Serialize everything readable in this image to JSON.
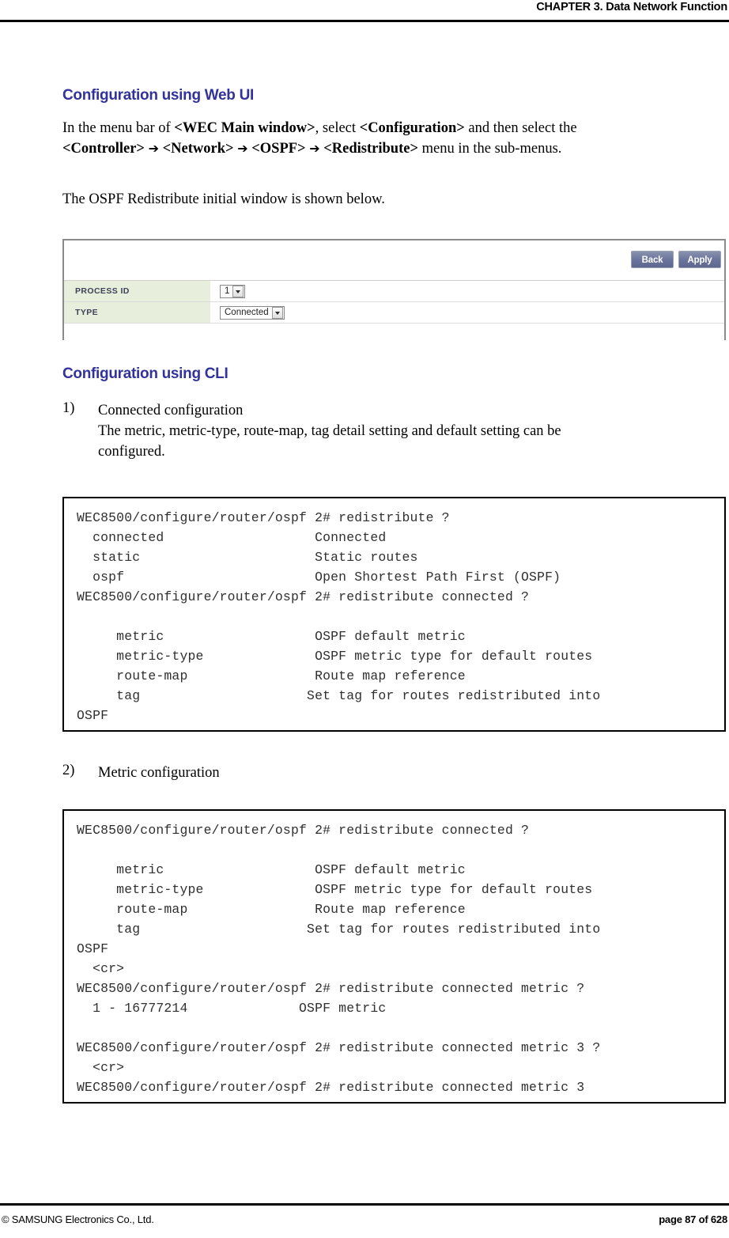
{
  "header": {
    "chapter_title": "CHAPTER 3. Data Network Function"
  },
  "sections": {
    "webui_heading": "Configuration using Web UI",
    "webui_para_line1_a": "In the menu bar of ",
    "webui_para_line1_b": "<WEC Main window>",
    "webui_para_line1_c": ", select ",
    "webui_para_line1_d": "<Configuration>",
    "webui_para_line1_e": " and then select the",
    "webui_para_line2_a": "<Controller>",
    "webui_para_line2_arrow1": "➔",
    "webui_para_line2_b": "<Network>",
    "webui_para_line2_arrow2": "➔",
    "webui_para_line2_c": "<OSPF>",
    "webui_para_line2_arrow3": "➔",
    "webui_para_line2_d": "<Redistribute>",
    "webui_para_line2_e": " menu in the sub-menus.",
    "webui_para2": "The OSPF Redistribute initial window is shown below.",
    "cli_heading": "Configuration using CLI"
  },
  "webui_panel": {
    "back_label": "Back",
    "apply_label": "Apply",
    "rows": [
      {
        "label": "PROCESS ID",
        "value": "1"
      },
      {
        "label": "TYPE",
        "value": "Connected"
      }
    ]
  },
  "cli_items": [
    {
      "number": "1)",
      "title": "Connected configuration",
      "desc_line1": "The metric, metric-type, route-map, tag detail setting and default setting can be",
      "desc_line2": "configured."
    },
    {
      "number": "2)",
      "title": "Metric configuration"
    }
  ],
  "cli_blocks": [
    {
      "id": "connected-configuration-output",
      "text": "WEC8500/configure/router/ospf 2# redistribute ?\n  connected                   Connected\n  static                      Static routes\n  ospf                        Open Shortest Path First (OSPF)\nWEC8500/configure/router/ospf 2# redistribute connected ?\n\n     metric                   OSPF default metric\n     metric-type              OSPF metric type for default routes\n     route-map                Route map reference\n     tag                     Set tag for routes redistributed into\nOSPF"
    },
    {
      "id": "metric-configuration-output",
      "text": "WEC8500/configure/router/ospf 2# redistribute connected ?\n\n     metric                   OSPF default metric\n     metric-type              OSPF metric type for default routes\n     route-map                Route map reference\n     tag                     Set tag for routes redistributed into\nOSPF\n  <cr>\nWEC8500/configure/router/ospf 2# redistribute connected metric ?\n  1 - 16777214              OSPF metric\n\nWEC8500/configure/router/ospf 2# redistribute connected metric 3 ?\n  <cr>\nWEC8500/configure/router/ospf 2# redistribute connected metric 3"
    }
  ],
  "footer": {
    "copyright": "© SAMSUNG Electronics Co., Ltd.",
    "page": "page 87 of 628"
  },
  "colors": {
    "heading_blue": "#32329b",
    "panel_label_bg": "#e8eedc",
    "button_blue": "#69739b"
  }
}
